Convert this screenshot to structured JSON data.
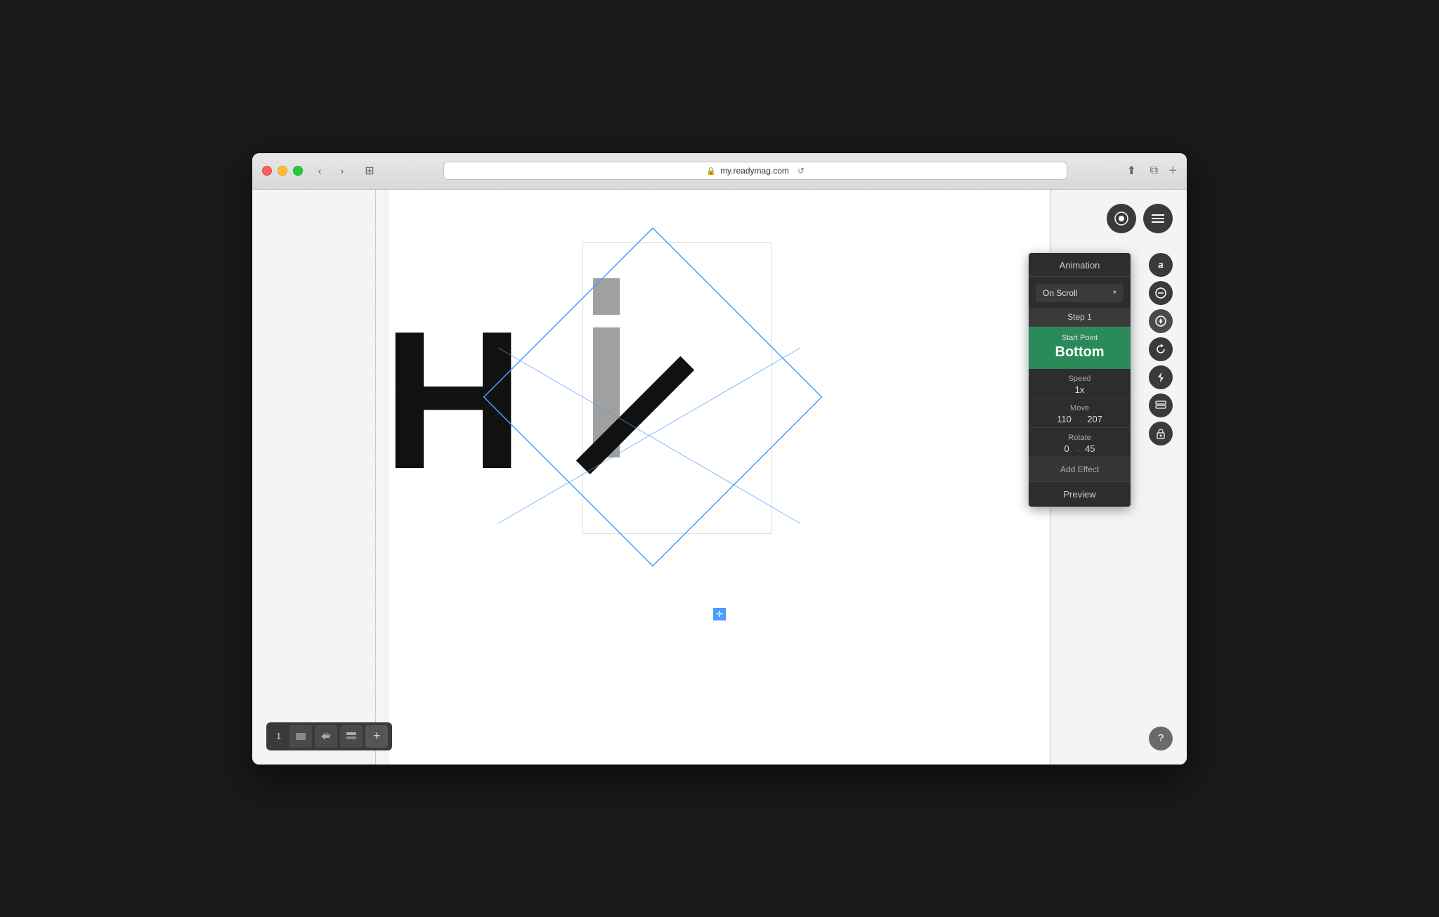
{
  "window": {
    "title": "my.readymag.com"
  },
  "titlebar": {
    "back_label": "‹",
    "forward_label": "›",
    "url": "my.readymag.com",
    "lock_icon": "🔒",
    "reload_icon": "↺",
    "share_icon": "⬆",
    "pip_icon": "⧉",
    "add_icon": "+"
  },
  "canvas": {
    "letter": "H",
    "guide_positions": [
      175,
      940
    ]
  },
  "top_toolbar": {
    "eye_icon": "👁",
    "menu_icon": "≡"
  },
  "animation_panel": {
    "title": "Animation",
    "trigger": "On Scroll",
    "step_label": "Step 1",
    "start_point_label": "Start Point",
    "start_point_value": "Bottom",
    "speed_label": "Speed",
    "speed_value": "1x",
    "move_label": "Move",
    "move_x": "110",
    "move_arrow": "→",
    "move_y": "207",
    "rotate_label": "Rotate",
    "rotate_from": "0",
    "rotate_arrow": "→",
    "rotate_to": "45",
    "add_effect_label": "Add Effect",
    "preview_label": "Preview"
  },
  "side_icons": [
    {
      "name": "text-icon",
      "symbol": "a"
    },
    {
      "name": "align-icon",
      "symbol": "⊟"
    },
    {
      "name": "scroll-icon",
      "symbol": "⟳"
    },
    {
      "name": "refresh-icon",
      "symbol": "↺"
    },
    {
      "name": "bolt-icon",
      "symbol": "⚡"
    },
    {
      "name": "layers-icon",
      "symbol": "◫"
    },
    {
      "name": "lock-icon",
      "symbol": "🔒"
    }
  ],
  "bottom_toolbar": {
    "page_number": "1",
    "page_icon": "⬛",
    "undo_redo_icon": "⇄",
    "layers_icon": "◫",
    "add_icon": "+"
  },
  "help": {
    "label": "?"
  }
}
